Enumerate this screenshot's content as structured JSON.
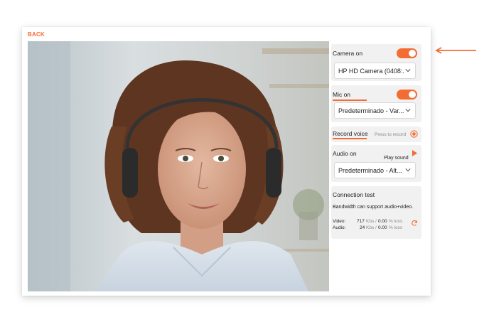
{
  "back_label": "BACK",
  "camera": {
    "title": "Camera on",
    "enabled": true,
    "device": "HP HD Camera (0408:..."
  },
  "mic": {
    "title": "Mic on",
    "enabled": true,
    "device": "Predeterminado - Var..."
  },
  "record": {
    "title": "Record voice",
    "hint": "Press to record"
  },
  "audio": {
    "title": "Audio on",
    "play_label": "Play sound",
    "device": "Predeterminado - Alt..."
  },
  "connection": {
    "title": "Connection test",
    "message": "Bandwidth can support audio+video.",
    "video": {
      "label": "Video:",
      "kbs": "717",
      "kbs_unit": "Kbs /",
      "loss": "0.00",
      "loss_unit": "% loss"
    },
    "audio": {
      "label": "Audio:",
      "kbs": "24",
      "kbs_unit": "Kbs /",
      "loss": "0.00",
      "loss_unit": "% loss"
    }
  },
  "colors": {
    "accent": "#f36c32",
    "panel_bg": "#f1f1f2"
  },
  "icons": {
    "refresh": "refresh-icon",
    "play": "play-icon",
    "record": "record-icon",
    "chevron": "chevron-down-icon"
  }
}
